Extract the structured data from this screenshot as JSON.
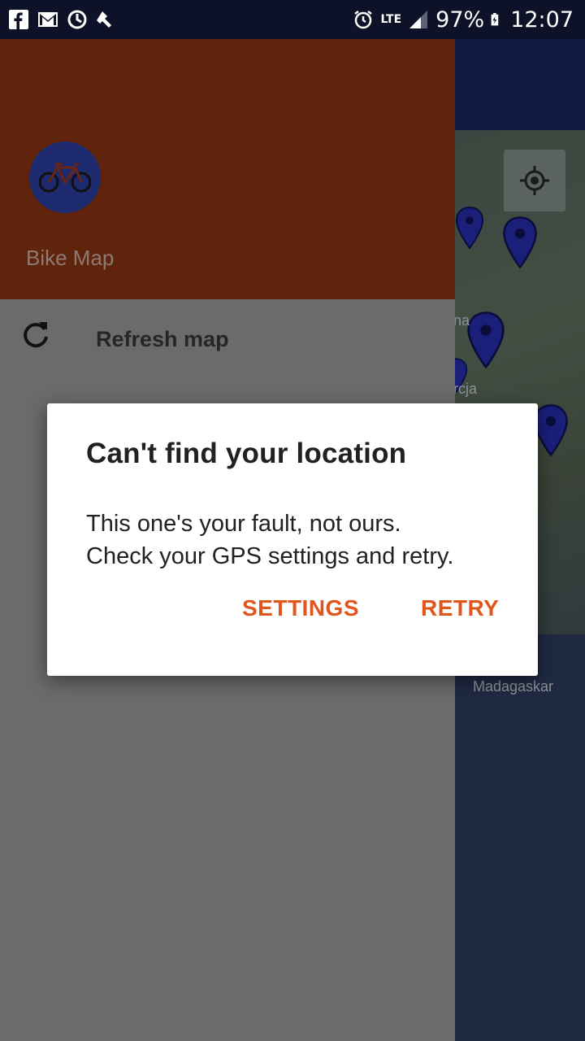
{
  "status_bar": {
    "left_icons": [
      "facebook-icon",
      "gmail-icon",
      "sync-icon",
      "tool-icon"
    ],
    "network": "LTE",
    "battery": "97%",
    "time": "12:07"
  },
  "drawer": {
    "app_name": "Bike Map",
    "items": [
      {
        "label": "Refresh map",
        "icon": "refresh-icon"
      }
    ]
  },
  "map": {
    "labels": [
      "na",
      "rcja",
      "Madagaskar"
    ]
  },
  "dialog": {
    "title": "Can't find your location",
    "message_line1": "This one's your fault, not ours.",
    "message_line2": "Check your GPS settings and retry.",
    "settings_label": "SETTINGS",
    "retry_label": "RETRY"
  },
  "colors": {
    "accent": "#e0561c",
    "header": "#5f240b",
    "avatar": "#1d2a6e",
    "pin": "#1a1f7a"
  }
}
